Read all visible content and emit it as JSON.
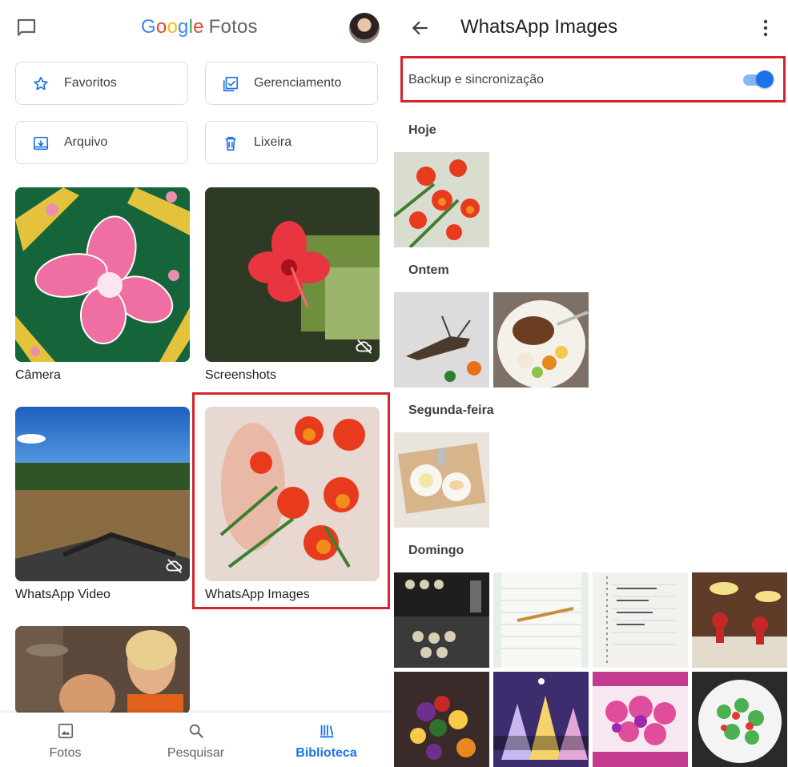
{
  "left": {
    "app_logo": "Google Fotos",
    "quick_buttons": [
      {
        "label": "Favoritos",
        "icon": "star-icon"
      },
      {
        "label": "Gerenciamento",
        "icon": "checklist-icon"
      },
      {
        "label": "Arquivo",
        "icon": "archive-icon"
      },
      {
        "label": "Lixeira",
        "icon": "trash-icon"
      }
    ],
    "albums": [
      {
        "label": "Câmera"
      },
      {
        "label": "Screenshots",
        "backup_off": true
      },
      {
        "label": "WhatsApp Video",
        "backup_off": true
      },
      {
        "label": "WhatsApp Images",
        "highlighted": true
      },
      {
        "label": ""
      }
    ],
    "bottom_nav": [
      {
        "label": "Fotos",
        "icon": "photo-icon"
      },
      {
        "label": "Pesquisar",
        "icon": "search-icon"
      },
      {
        "label": "Biblioteca",
        "icon": "library-icon",
        "active": true
      }
    ]
  },
  "right": {
    "title": "WhatsApp Images",
    "backup": {
      "label": "Backup e sincronização",
      "enabled": true,
      "highlighted": true
    },
    "sections": [
      {
        "label": "Hoje",
        "photo_count": 1
      },
      {
        "label": "Ontem",
        "photo_count": 2
      },
      {
        "label": "Segunda-feira",
        "photo_count": 1
      },
      {
        "label": "Domingo",
        "photo_count": 8
      }
    ]
  },
  "colors": {
    "accent": "#1a73e8",
    "highlight_box": "#d5232f"
  }
}
